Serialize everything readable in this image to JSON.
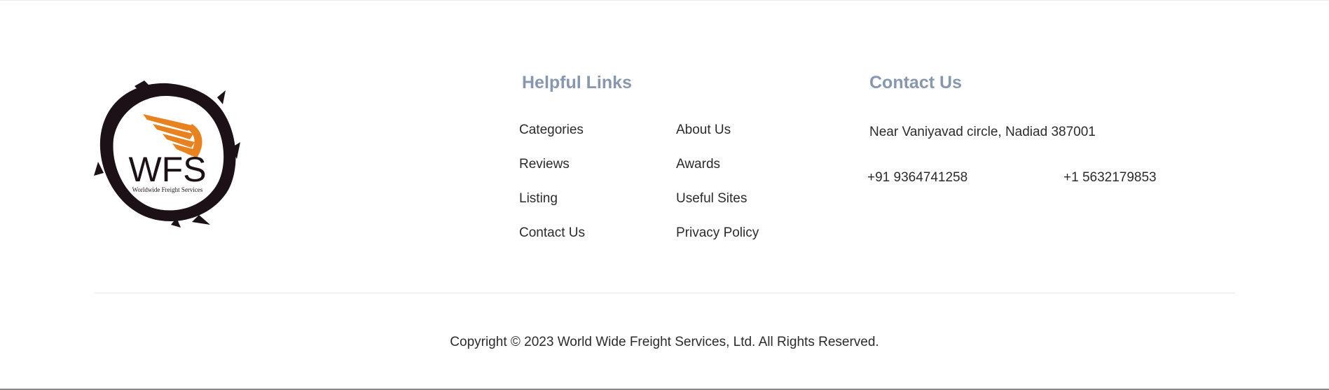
{
  "logo": {
    "mark_text": "WFS",
    "tagline": "Worldwide Freight Services",
    "colors": {
      "ring": "#1b1117",
      "wing": "#e8821f"
    }
  },
  "helpful_links": {
    "heading": "Helpful Links",
    "column1": [
      "Categories",
      "Reviews",
      "Listing",
      "Contact Us"
    ],
    "column2": [
      "About Us",
      "Awards",
      "Useful Sites",
      "Privacy Policy"
    ]
  },
  "contact": {
    "heading": "Contact Us",
    "address": "Near Vaniyavad circle, Nadiad 387001",
    "phones": [
      "+91 9364741258",
      "+1 5632179853"
    ]
  },
  "footer": {
    "copyright": "Copyright © 2023 World Wide Freight Services, Ltd. All Rights Reserved."
  },
  "colors": {
    "heading": "#8797ad",
    "text": "#2b2b2b",
    "divider": "#e6e6e6"
  }
}
